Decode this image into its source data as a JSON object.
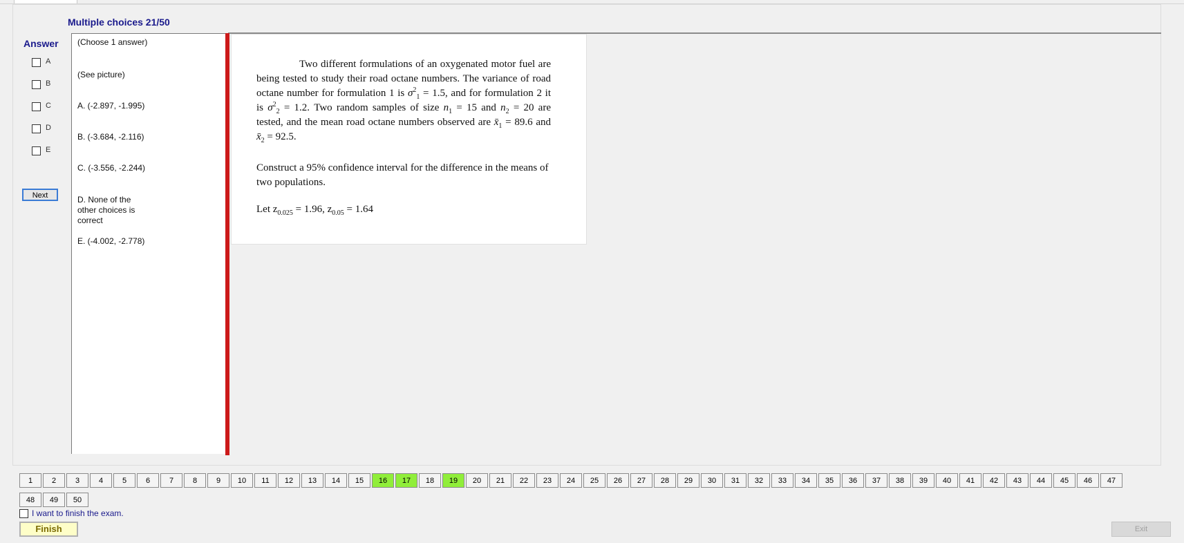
{
  "header": {
    "section_title": "Multiple choices 21/50"
  },
  "answer_panel": {
    "heading": "Answer",
    "options": [
      "A",
      "B",
      "C",
      "D",
      "E"
    ],
    "next_label": "Next"
  },
  "choices": {
    "instruction": "(Choose 1 answer)",
    "see_picture": "(See picture)",
    "items": [
      "A. (-2.897, -1.995)",
      "B. (-3.684, -2.116)",
      "C. (-3.556, -2.244)",
      "D. None of the other choices is correct",
      "E. (-4.002, -2.778)"
    ]
  },
  "question": {
    "p1": {
      "intro": "Two different formulations of an oxygenated motor fuel are being tested to study their road octane numbers. The variance of road octane number for formulation 1 is ",
      "s1_sym": "σ",
      "s1_sub": "1",
      "s1_sup": "2",
      "s1_val": " = 1.5, and for formulation 2 it is ",
      "s2_sym": "σ",
      "s2_sub": "2",
      "s2_sup": "2",
      "s2_val": " = 1.2. Two random samples of size ",
      "n1_sym": "n",
      "n1_sub": "1",
      "n1_val": " = 15 and ",
      "n2_sym": "n",
      "n2_sub": "2",
      "n2_val": " = 20 are tested, and the mean road octane numbers observed are ",
      "x1_sym": "x̄",
      "x1_sub": "1",
      "x1_val": " = 89.6 and ",
      "x2_sym": "x̄",
      "x2_sub": "2",
      "x2_val": " = 92.5."
    },
    "p2": "Construct a 95% confidence interval for the difference in the means of two populations.",
    "p3": {
      "let": "Let z",
      "z1_sub": "0.025",
      "z1_val": " = 1.96,   z",
      "z2_sub": "0.05",
      "z2_val": " = 1.64"
    }
  },
  "navigation": {
    "questions": [
      "1",
      "2",
      "3",
      "4",
      "5",
      "6",
      "7",
      "8",
      "9",
      "10",
      "11",
      "12",
      "13",
      "14",
      "15",
      "16",
      "17",
      "18",
      "19",
      "20",
      "21",
      "22",
      "23",
      "24",
      "25",
      "26",
      "27",
      "28",
      "29",
      "30",
      "31",
      "32",
      "33",
      "34",
      "35",
      "36",
      "37",
      "38",
      "39",
      "40",
      "41",
      "42",
      "43",
      "44",
      "45",
      "46",
      "47",
      "48",
      "49",
      "50"
    ],
    "answered": [
      "16",
      "17",
      "19"
    ]
  },
  "footer": {
    "finish_check_label": "I want to finish the exam.",
    "finish_label": "Finish",
    "exit_label": "Exit"
  },
  "colors": {
    "accent_text": "#1a1a8c",
    "answered_bg": "#90ee3a",
    "divider_red": "#cc1a1a",
    "finish_bg": "#fefec8"
  }
}
